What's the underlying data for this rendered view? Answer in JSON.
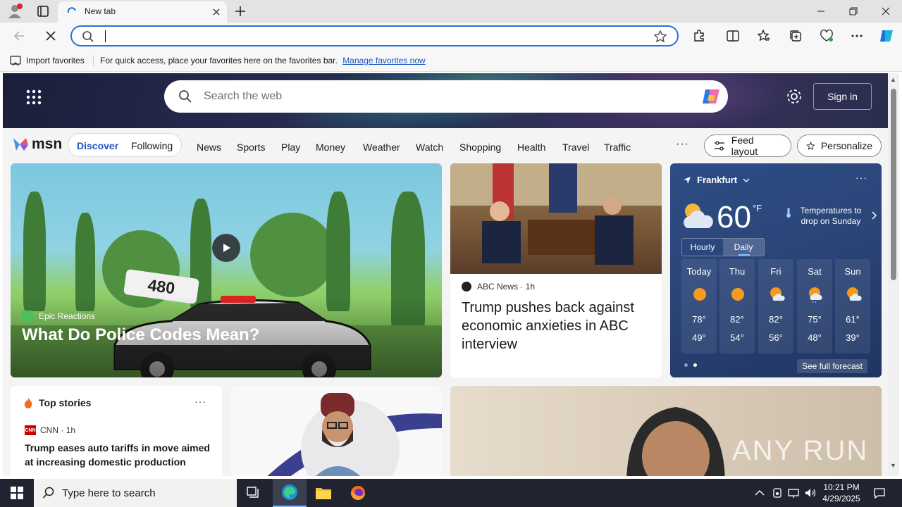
{
  "browser": {
    "tab": {
      "title": "New tab"
    },
    "address": {
      "value": ""
    },
    "favbar": {
      "import_label": "Import favorites",
      "message": "For quick access, place your favorites here on the favorites bar.",
      "link": "Manage favorites now"
    }
  },
  "msn": {
    "search_placeholder": "Search the web",
    "signin_label": "Sign in",
    "logo_text": "msn",
    "pivot": {
      "discover": "Discover",
      "following": "Following"
    },
    "nav": [
      "News",
      "Sports",
      "Play",
      "Money",
      "Weather",
      "Watch",
      "Shopping",
      "Health",
      "Travel",
      "Traffic"
    ],
    "more_nav": "···",
    "feed_layout": "Feed layout",
    "personalize": "Personalize",
    "hero": {
      "source": "Epic Reactions",
      "headline": "What Do Police Codes Mean?",
      "sign_text": "480"
    },
    "news": {
      "source": "ABC News",
      "age": " · 1h",
      "headline": "Trump pushes back against economic anxieties in ABC interview"
    },
    "weather": {
      "location": "Frankfurt",
      "temp": "60",
      "unit": "°F",
      "alert": "Temperatures to drop on Sunday",
      "tab_hourly": "Hourly",
      "tab_daily": "Daily",
      "days": [
        {
          "name": "Today",
          "hi": "78°",
          "lo": "49°",
          "icon": "sun-icon"
        },
        {
          "name": "Thu",
          "hi": "82°",
          "lo": "54°",
          "icon": "sun-icon"
        },
        {
          "name": "Fri",
          "hi": "82°",
          "lo": "56°",
          "icon": "partly-sunny-icon"
        },
        {
          "name": "Sat",
          "hi": "75°",
          "lo": "48°",
          "icon": "partly-sunny-icon"
        },
        {
          "name": "Sun",
          "hi": "61°",
          "lo": "39°",
          "icon": "partly-sunny-icon"
        }
      ],
      "see_forecast": "See full forecast"
    },
    "top_stories": {
      "title": "Top stories",
      "source": "CNN",
      "age": " · 1h",
      "headline": "Trump eases auto tariffs in move aimed at increasing domestic production"
    },
    "watermark": "ANY RUN"
  },
  "taskbar": {
    "search_placeholder": "Type here to search",
    "time": "10:21 PM",
    "date": "4/29/2025"
  },
  "colors": {
    "accent": "#1a56c4",
    "omnibox_border": "#2a6fdb",
    "taskbar": "#1f2430"
  }
}
